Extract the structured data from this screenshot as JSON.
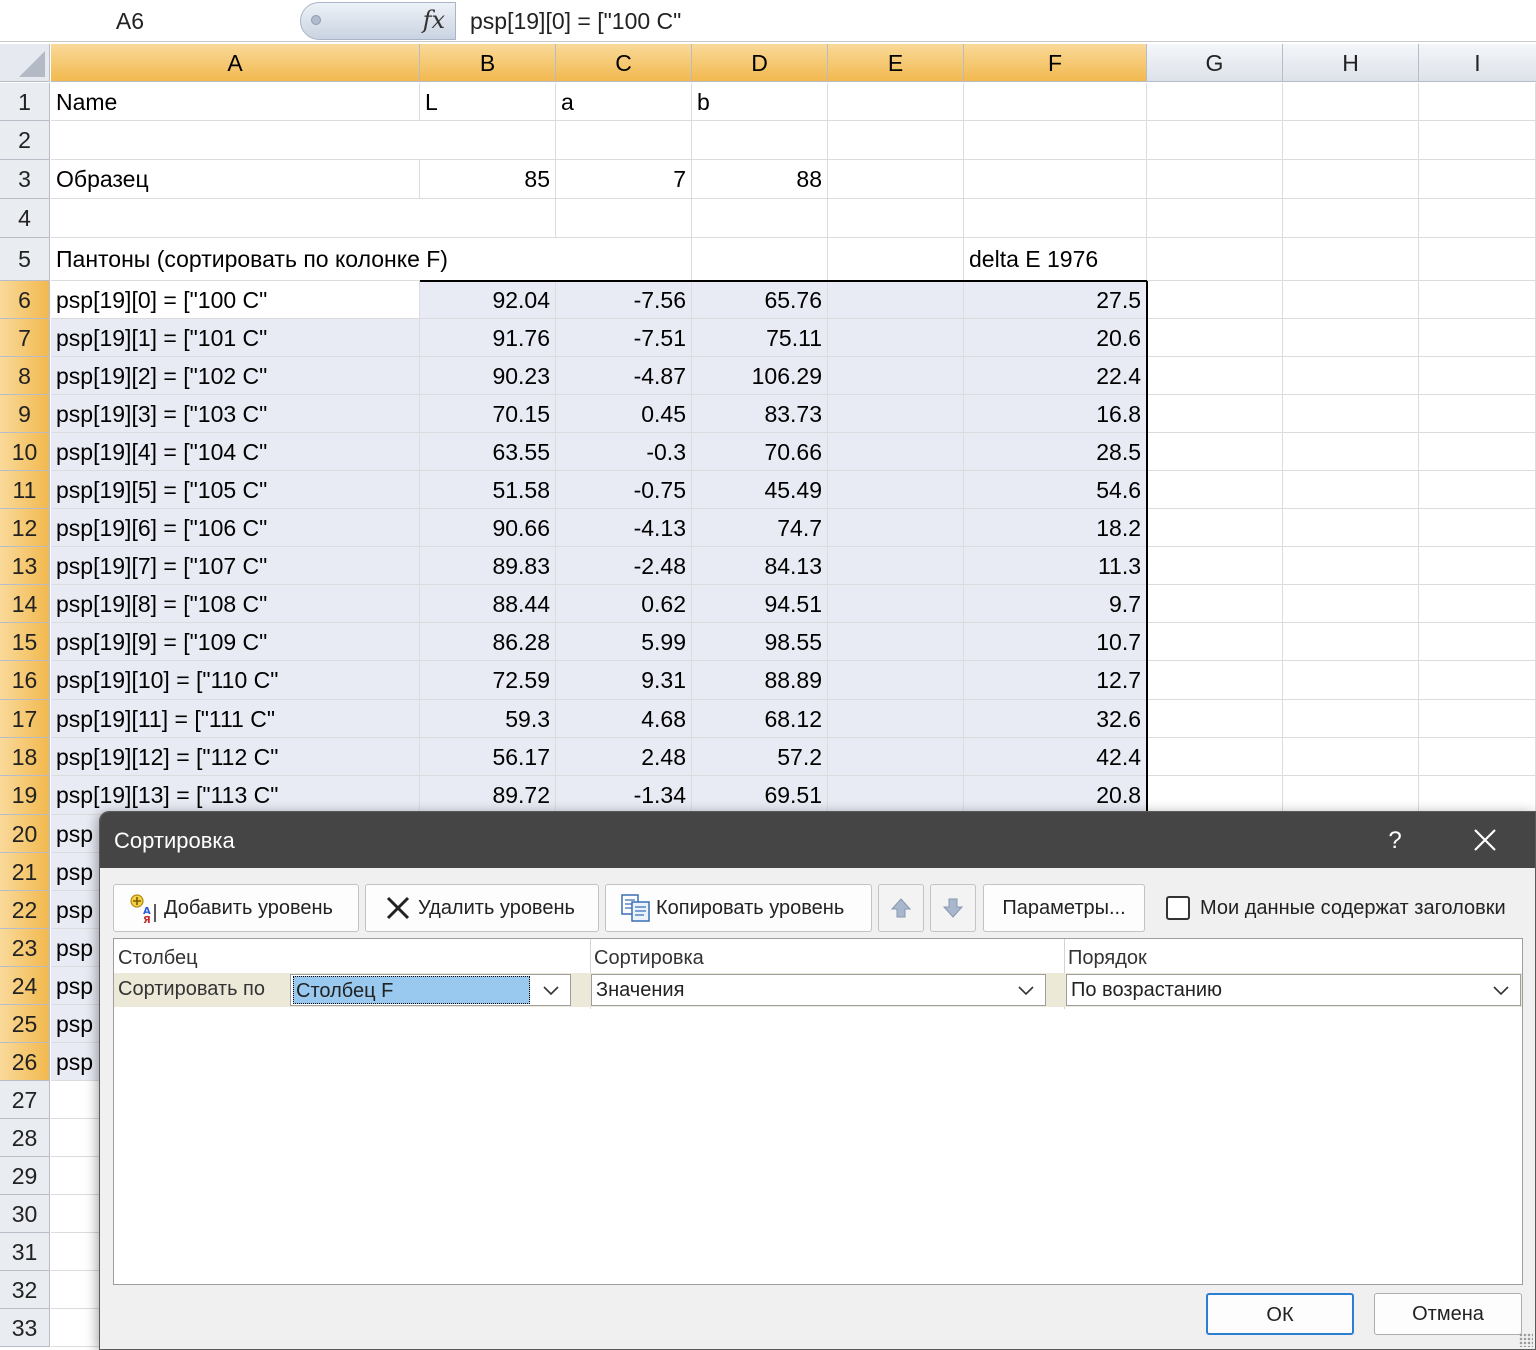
{
  "formula_bar": {
    "name_box": "A6",
    "fx_symbol": "fx",
    "formula": "psp[19][0] = [\"100 C\""
  },
  "columns": [
    "A",
    "B",
    "C",
    "D",
    "E",
    "F",
    "G",
    "H",
    "I"
  ],
  "rows": [
    "1",
    "2",
    "3",
    "4",
    "5",
    "6",
    "7",
    "8",
    "9",
    "10",
    "11",
    "12",
    "13",
    "14",
    "15",
    "16",
    "17",
    "18",
    "19",
    "20",
    "21",
    "22",
    "23",
    "24",
    "25",
    "26",
    "27",
    "28",
    "29",
    "30",
    "31",
    "32",
    "33"
  ],
  "sheet": {
    "r1": {
      "a": "Name",
      "b": "L",
      "c": "a",
      "d": "b"
    },
    "r3": {
      "a": "Образец",
      "b": "85",
      "c": "7",
      "d": "88"
    },
    "r5": {
      "a": "Пантоны (сортировать по колонке F)",
      "f": "delta E 1976"
    },
    "data": [
      {
        "a": "psp[19][0] = [\"100 C\"",
        "b": "92.04",
        "c": "-7.56",
        "d": "65.76",
        "f": "27.5"
      },
      {
        "a": "psp[19][1] = [\"101 C\"",
        "b": "91.76",
        "c": "-7.51",
        "d": "75.11",
        "f": "20.6"
      },
      {
        "a": "psp[19][2] = [\"102 C\"",
        "b": "90.23",
        "c": "-4.87",
        "d": "106.29",
        "f": "22.4"
      },
      {
        "a": "psp[19][3] = [\"103 C\"",
        "b": "70.15",
        "c": "0.45",
        "d": "83.73",
        "f": "16.8"
      },
      {
        "a": "psp[19][4] = [\"104 C\"",
        "b": "63.55",
        "c": "-0.3",
        "d": "70.66",
        "f": "28.5"
      },
      {
        "a": "psp[19][5] = [\"105 C\"",
        "b": "51.58",
        "c": "-0.75",
        "d": "45.49",
        "f": "54.6"
      },
      {
        "a": "psp[19][6] = [\"106 C\"",
        "b": "90.66",
        "c": "-4.13",
        "d": "74.7",
        "f": "18.2"
      },
      {
        "a": "psp[19][7] = [\"107 C\"",
        "b": "89.83",
        "c": "-2.48",
        "d": "84.13",
        "f": "11.3"
      },
      {
        "a": "psp[19][8] = [\"108 C\"",
        "b": "88.44",
        "c": "0.62",
        "d": "94.51",
        "f": "9.7"
      },
      {
        "a": "psp[19][9] = [\"109 C\"",
        "b": "86.28",
        "c": "5.99",
        "d": "98.55",
        "f": "10.7"
      },
      {
        "a": "psp[19][10] = [\"110 C\"",
        "b": "72.59",
        "c": "9.31",
        "d": "88.89",
        "f": "12.7"
      },
      {
        "a": "psp[19][11] = [\"111 C\"",
        "b": "59.3",
        "c": "4.68",
        "d": "68.12",
        "f": "32.6"
      },
      {
        "a": "psp[19][12] = [\"112 C\"",
        "b": "56.17",
        "c": "2.48",
        "d": "57.2",
        "f": "42.4"
      },
      {
        "a": "psp[19][13] = [\"113 C\"",
        "b": "89.72",
        "c": "-1.34",
        "d": "69.51",
        "f": "20.8"
      }
    ],
    "hidden_a": [
      "psp",
      "psp",
      "psp",
      "psp",
      "psp",
      "psp",
      "psp"
    ]
  },
  "dialog": {
    "title": "Сортировка",
    "help": "?",
    "close": "✕",
    "toolbar": {
      "add_level": "Добавить уровень",
      "delete_level": "Удалить уровень",
      "copy_level": "Копировать уровень",
      "options": "Параметры...",
      "headers_checkbox": "Мои данные содержат заголовки"
    },
    "headers": {
      "column": "Столбец",
      "sort_on": "Сортировка",
      "order": "Порядок"
    },
    "level": {
      "label": "Сортировать по",
      "column": "Столбец F",
      "sort_on": "Значения",
      "order": "По возрастанию"
    },
    "ok": "ОК",
    "cancel": "Отмена"
  },
  "colors": {
    "selection_header": "#f2b94e",
    "selection_fill": "#e8ebf4",
    "dialog_title_bg": "#454545"
  }
}
